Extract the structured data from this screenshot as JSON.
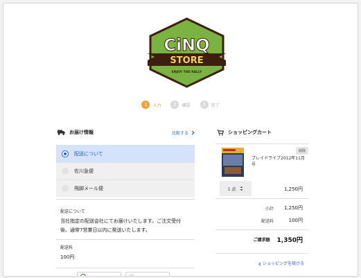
{
  "logo": {
    "brand": "CiNQ",
    "store": "STORE",
    "tagline": "ENJOY THE RALLY",
    "colors": {
      "green": "#7bb342",
      "dark": "#3d1f0e",
      "accent": "#f0d060"
    }
  },
  "steps": [
    {
      "num": "1",
      "label": "入力",
      "active": true
    },
    {
      "num": "2",
      "label": "確認",
      "active": false
    },
    {
      "num": "3",
      "label": "完了",
      "active": false
    }
  ],
  "delivery": {
    "title": "お届け情報",
    "compare": "比較する",
    "options": [
      {
        "label": "配送について",
        "selected": true
      },
      {
        "label": "佐川急便",
        "selected": false
      },
      {
        "label": "飛脚メール便",
        "selected": false
      }
    ],
    "info_label": "配送について",
    "info_text": "当社指定の配送会社にてお届けいたします。ご注文受付後、通常7営業日以内に発送いたします。",
    "fee_label": "配送料",
    "fee_value": "100円"
  },
  "cart": {
    "title": "ショッピングカート",
    "item": {
      "name": "プレイドライブ2012年11月号",
      "delete": "削除",
      "qty": "1 点",
      "price": "1,250円"
    },
    "subtotal_label": "小計",
    "subtotal": "1,250円",
    "shipping_label": "配送料",
    "shipping": "100円",
    "total_label": "ご請求額",
    "total": "1,350円",
    "continue": "ショッピングを続ける"
  },
  "colors": {
    "accent_orange": "#f0a13a",
    "link_blue": "#2b6cd4",
    "selected_bg": "#d4e2fb"
  }
}
